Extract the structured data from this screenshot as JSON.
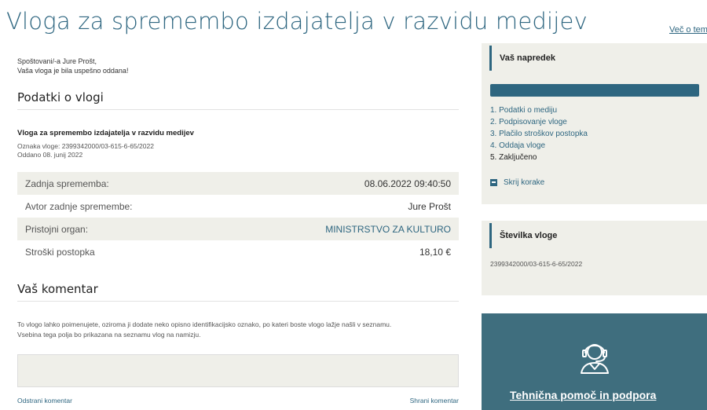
{
  "header": {
    "title": "Vloga za spremembo izdajatelja v razvidu medijev",
    "more_link": "Več o tem"
  },
  "greeting": {
    "line1": "Spoštovani/-a Jure Prošt,",
    "line2": "Vaša vloga je bila uspešno oddana!"
  },
  "application": {
    "section_title": "Podatki o vlogi",
    "name": "Vloga za spremembo izdajatelja v razvidu medijev",
    "reference_label": "Oznaka vloge:",
    "reference_value": "2399342000/03-615-6-65/2022",
    "submitted_label": "Oddano",
    "submitted_value": "08. junij 2022",
    "rows": [
      {
        "key": "Zadnja sprememba:",
        "value": "08.06.2022 09:40:50"
      },
      {
        "key": "Avtor zadnje spremembe:",
        "value": "Jure Prošt"
      },
      {
        "key": "Pristojni organ:",
        "value": "MINISTRSTVO ZA KULTURO"
      },
      {
        "key": "Stroški postopka",
        "value": "18,10 €"
      }
    ]
  },
  "comment": {
    "section_title": "Vaš komentar",
    "help_line1": "To vlogo lahko poimenujete, oziroma ji dodate neko opisno identifikacijsko oznako, po kateri boste vlogo lažje našli v seznamu.",
    "help_line2": "Vsebina tega polja bo prikazana na seznamu vlog na namizju.",
    "value": "",
    "remove_label": "Odstrani komentar",
    "save_label": "Shrani komentar"
  },
  "progress": {
    "title": "Vaš napredek",
    "fraction": 1.0,
    "steps": [
      "1.  Podatki o mediju",
      "2.  Podpisovanje vloge",
      "3.  Plačilo stroškov postopka",
      "4.  Oddaja vloge",
      "5.  Zaključeno"
    ],
    "hide_label": "Skrij korake"
  },
  "number": {
    "title": "Številka vloge",
    "value": "2399342000/03-615-6-65/2022"
  },
  "support": {
    "title": "Tehnična pomoč in podpora",
    "icon": "headset-icon"
  },
  "colors": {
    "accent": "#2e6680",
    "panel": "#efefe9",
    "support_bg": "#3f6e7e"
  }
}
